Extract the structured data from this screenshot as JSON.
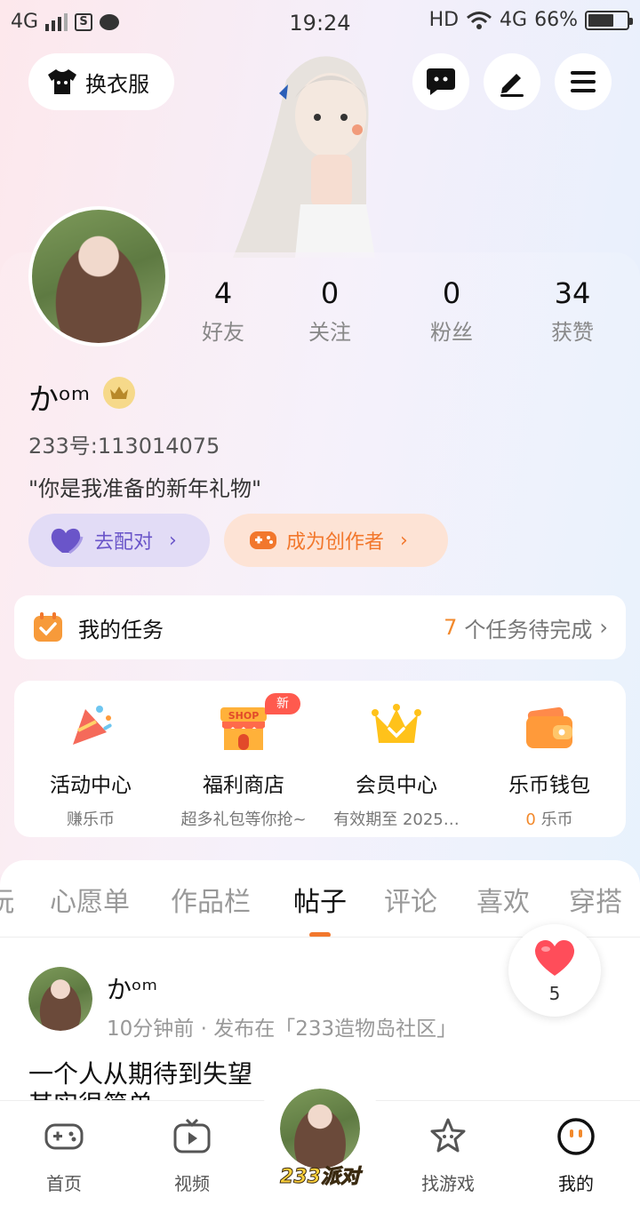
{
  "status_bar": {
    "network_left": "4G",
    "time": "19:24",
    "hd": "HD",
    "network_right": "4G",
    "battery": "66%"
  },
  "header": {
    "outfit_label": "换衣服"
  },
  "profile": {
    "stats": [
      {
        "value": "4",
        "label": "好友"
      },
      {
        "value": "0",
        "label": "关注"
      },
      {
        "value": "0",
        "label": "粉丝"
      },
      {
        "value": "34",
        "label": "获赞"
      }
    ],
    "name": "かᵒᵐ",
    "uid": "233号:113014075",
    "bio": "\"你是我准备的新年礼物\"",
    "match_label": "去配对",
    "creator_label": "成为创作者"
  },
  "tasks": {
    "title": "我的任务",
    "count": "7",
    "suffix": "个任务待完成"
  },
  "features": [
    {
      "title": "活动中心",
      "subtitle": "赚乐币"
    },
    {
      "title": "福利商店",
      "subtitle": "超多礼包等你抢~",
      "badge": "新"
    },
    {
      "title": "会员中心",
      "subtitle": "有效期至 2025…"
    },
    {
      "title": "乐币钱包",
      "subtitle_value": "0",
      "subtitle": "乐币"
    }
  ],
  "tabs": [
    "玩",
    "心愿单",
    "作品栏",
    "帖子",
    "评论",
    "喜欢",
    "穿搭"
  ],
  "post": {
    "author": "かᵒᵐ",
    "meta": "10分钟前 · 发布在「233造物岛社区」",
    "text": "一个人从期待到失望",
    "text2": "其实很简单",
    "likes": "5"
  },
  "bottom_nav": {
    "home": "首页",
    "video": "视频",
    "center": "233派对",
    "games": "找游戏",
    "mine": "我的"
  },
  "colors": {
    "accent_orange": "#f2772c",
    "purple": "#6a55c9",
    "new_badge": "#ff5a4e"
  }
}
